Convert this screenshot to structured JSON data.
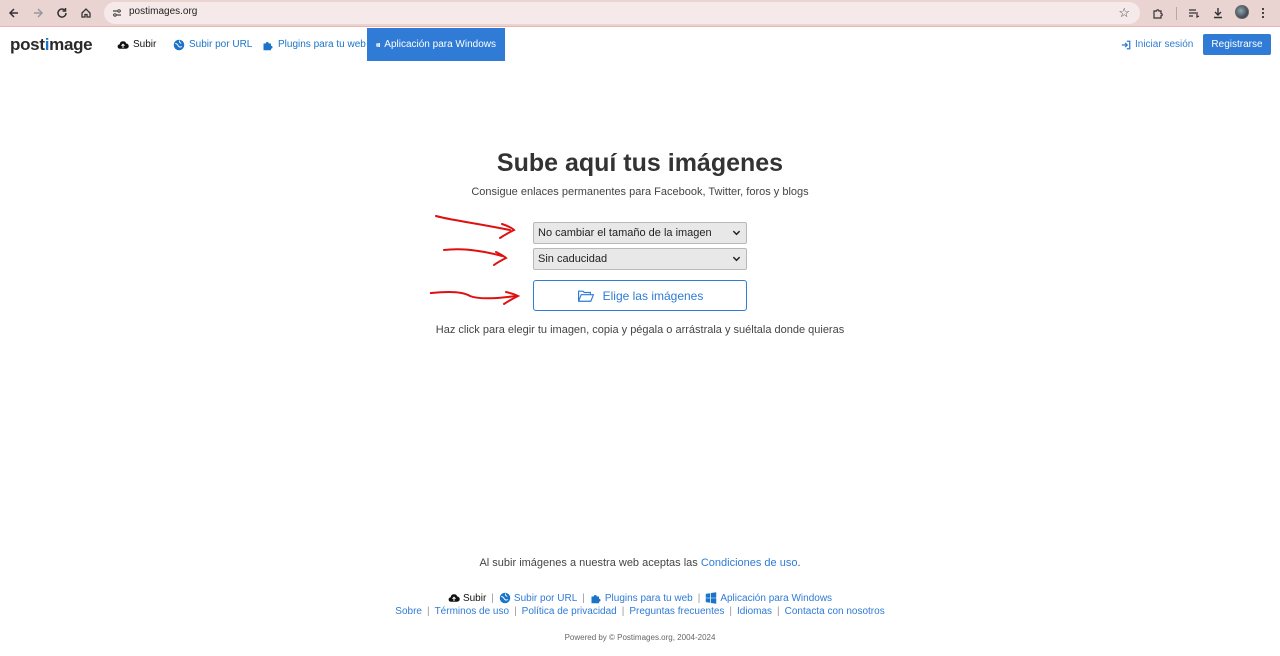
{
  "browser": {
    "url": "postimages.org",
    "icons": [
      "back-icon",
      "forward-icon",
      "reload-icon",
      "home-icon",
      "site-settings-icon",
      "bookmark-star-icon",
      "extensions-icon",
      "reading-list-icon",
      "download-icon",
      "profile-avatar",
      "menu-dots-icon"
    ]
  },
  "navbar": {
    "logo_pre": "post",
    "logo_o": "i",
    "logo_post": "mage",
    "upload": "Subir",
    "upload_url": "Subir por URL",
    "plugins": "Plugins para tu web",
    "windows_app": "Aplicación para Windows",
    "login": "Iniciar sesión",
    "register": "Registrarse"
  },
  "main": {
    "title": "Sube aquí tus imágenes",
    "subtitle": "Consigue enlaces permanentes para Facebook, Twitter, foros y blogs",
    "resize_select": "No cambiar el tamaño de la imagen",
    "expiry_select": "Sin caducidad",
    "choose_button": "Elige las imágenes",
    "hint": "Haz click para elegir tu imagen, copia y pégala o arrástrala y suéltala donde quieras"
  },
  "footer": {
    "terms_prefix": "Al subir imágenes a nuestra web aceptas las",
    "terms_link": "Condiciones de uso",
    "terms_suffix": ".",
    "row1": [
      "Subir",
      "Subir por URL",
      "Plugins para tu web",
      "Aplicación para Windows"
    ],
    "row2": [
      "Sobre",
      "Términos de uso",
      "Política de privacidad",
      "Preguntas frecuentes",
      "Idiomas",
      "Contacta con nosotros"
    ],
    "powered": "Powered by © Postimages.org, 2004-2024"
  },
  "colors": {
    "accent": "#2f7bd5",
    "annotation_arrows": "#e01010",
    "chrome_bar": "#e9d4d2"
  }
}
